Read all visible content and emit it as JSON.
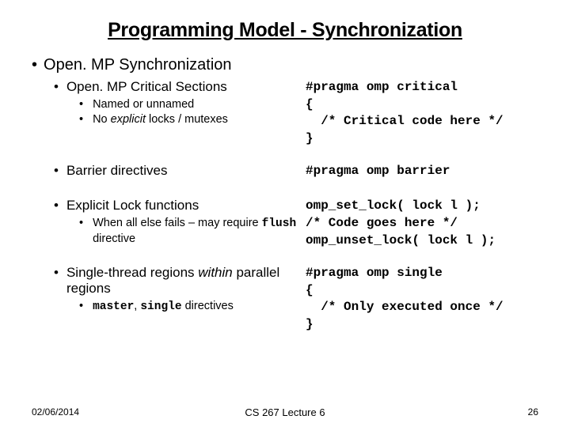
{
  "title": "Programming Model - Synchronization",
  "heading1": "Open. MP Synchronization",
  "sections": {
    "critical": {
      "heading": "Open. MP Critical Sections",
      "sub1": "Named or unnamed",
      "sub2_pre": "No ",
      "sub2_em": "explicit",
      "sub2_post": " locks / mutexes",
      "code": "#pragma omp critical\n{\n  /* Critical code here */\n}"
    },
    "barrier": {
      "heading": "Barrier directives",
      "code": "#pragma omp barrier"
    },
    "lock": {
      "heading": "Explicit Lock functions",
      "sub_pre": "When all else fails – may require ",
      "sub_code": "flush",
      "sub_post": " directive",
      "code": "omp_set_lock( lock l );\n/* Code goes here */\nomp_unset_lock( lock l );"
    },
    "single": {
      "heading_pre": "Single-thread regions ",
      "heading_em": "within",
      "heading_post": " parallel regions",
      "sub_code1": "master",
      "sub_mid": ", ",
      "sub_code2": "single",
      "sub_post": " directives",
      "code": "#pragma omp single\n{\n  /* Only executed once */\n}"
    }
  },
  "footer": {
    "date": "02/06/2014",
    "center": "CS 267 Lecture 6",
    "page": "26"
  }
}
